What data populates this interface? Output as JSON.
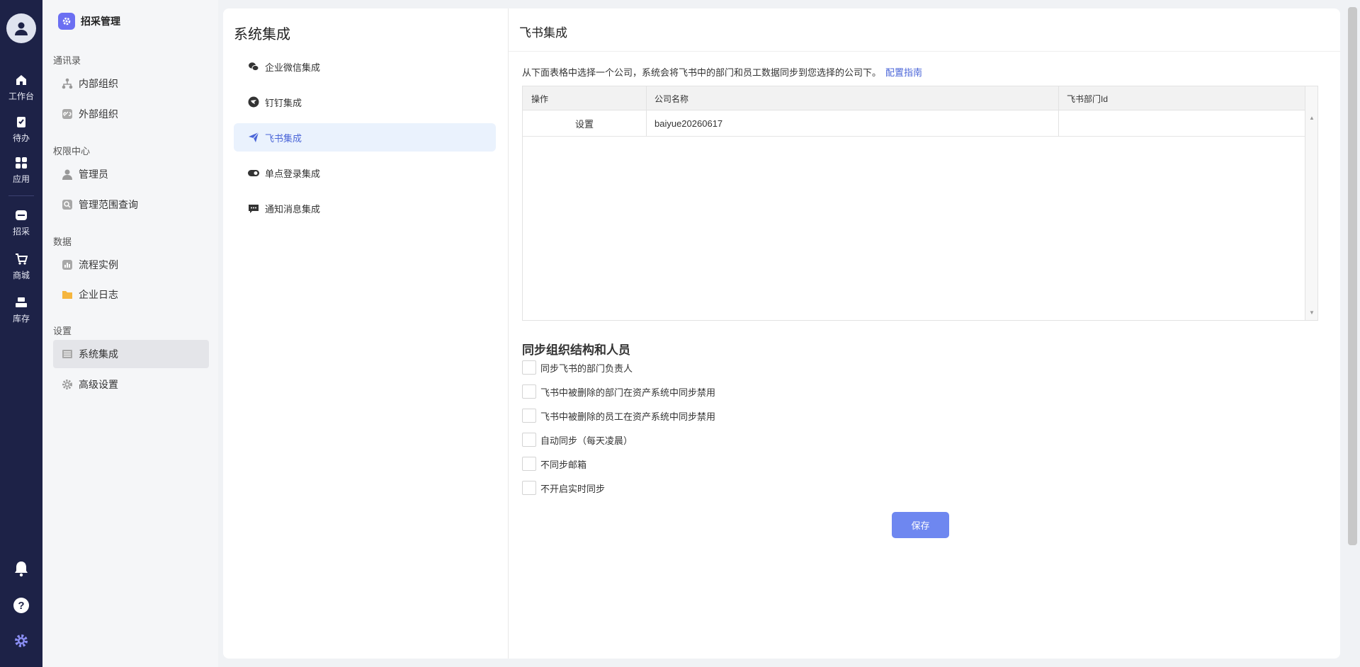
{
  "rail": {
    "items": [
      {
        "label": "工作台",
        "icon": "home-icon"
      },
      {
        "label": "待办",
        "icon": "clipboard-check-icon"
      },
      {
        "label": "应用",
        "icon": "apps-grid-icon"
      },
      {
        "label": "招采",
        "icon": "srm-icon"
      },
      {
        "label": "商城",
        "icon": "cart-icon"
      },
      {
        "label": "库存",
        "icon": "inventory-icon"
      }
    ],
    "bottom": [
      "bell-icon",
      "help-icon",
      "settings-gear-icon"
    ]
  },
  "sidebar": {
    "app_title": "招采管理",
    "groups": [
      {
        "label": "通讯录",
        "items": [
          {
            "label": "内部组织",
            "icon": "org-tree-icon"
          },
          {
            "label": "外部组织",
            "icon": "link-icon"
          }
        ]
      },
      {
        "label": "权限中心",
        "items": [
          {
            "label": "管理员",
            "icon": "user-icon"
          },
          {
            "label": "管理范围查询",
            "icon": "search-icon"
          }
        ]
      },
      {
        "label": "数据",
        "items": [
          {
            "label": "流程实例",
            "icon": "chart-icon"
          },
          {
            "label": "企业日志",
            "icon": "folder-icon"
          }
        ]
      },
      {
        "label": "设置",
        "items": [
          {
            "label": "系统集成",
            "icon": "integration-icon"
          },
          {
            "label": "高级设置",
            "icon": "gear-icon"
          }
        ]
      }
    ],
    "active": "系统集成"
  },
  "subnav": {
    "title": "系统集成",
    "items": [
      {
        "label": "企业微信集成",
        "icon": "wechat-icon"
      },
      {
        "label": "钉钉集成",
        "icon": "dingtalk-icon"
      },
      {
        "label": "飞书集成",
        "icon": "feishu-icon"
      },
      {
        "label": "单点登录集成",
        "icon": "toggle-icon"
      },
      {
        "label": "通知消息集成",
        "icon": "message-icon"
      }
    ],
    "active": "飞书集成"
  },
  "main": {
    "title": "飞书集成",
    "description": "从下面表格中选择一个公司，系统会将飞书中的部门和员工数据同步到您选择的公司下。",
    "guide_link": "配置指南",
    "table": {
      "columns": [
        "操作",
        "公司名称",
        "飞书部门Id"
      ],
      "rows": [
        {
          "action": "设置",
          "company": "baiyue20260617",
          "dept_id": ""
        }
      ]
    },
    "sync_section_title": "同步组织结构和人员",
    "options": [
      {
        "label": "同步飞书的部门负责人",
        "checked": false
      },
      {
        "label": "飞书中被删除的部门在资产系统中同步禁用",
        "checked": false
      },
      {
        "label": "飞书中被删除的员工在资产系统中同步禁用",
        "checked": false
      },
      {
        "label": "自动同步（每天凌晨）",
        "checked": false
      },
      {
        "label": "不同步邮箱",
        "checked": false
      },
      {
        "label": "不开启实时同步",
        "checked": false
      }
    ],
    "save_label": "保存"
  },
  "colors": {
    "rail_bg": "#1d2247",
    "accent": "#6e87f0",
    "link": "#4a65d8"
  }
}
